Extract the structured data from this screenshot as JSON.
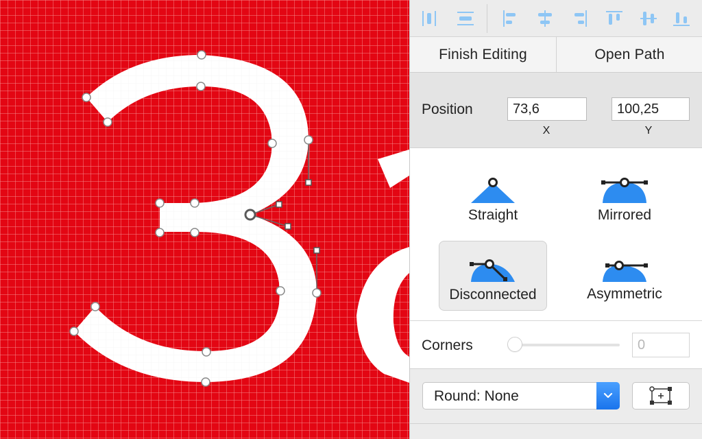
{
  "colors": {
    "canvas_red": "#e30613",
    "grid": "#f38a8a",
    "accent_blue": "#2d8cf0",
    "icon_blue": "#8ec6f5"
  },
  "toolbar": {
    "icons": [
      "distribute-horizontal-icon",
      "distribute-vertical-icon",
      "align-left-icon",
      "align-horizontal-center-icon",
      "align-right-icon",
      "align-top-icon",
      "align-vertical-center-icon",
      "align-bottom-icon"
    ]
  },
  "edit_bar": {
    "finish_label": "Finish Editing",
    "open_path_label": "Open Path"
  },
  "position": {
    "label": "Position",
    "x_value": "73,6",
    "y_value": "100,25",
    "x_caption": "X",
    "y_caption": "Y"
  },
  "point_types": {
    "selected": "Disconnected",
    "options": [
      {
        "label": "Straight",
        "icon": "straight-point-icon"
      },
      {
        "label": "Mirrored",
        "icon": "mirrored-point-icon"
      },
      {
        "label": "Disconnected",
        "icon": "disconnected-point-icon"
      },
      {
        "label": "Asymmetric",
        "icon": "asymmetric-point-icon"
      }
    ]
  },
  "corners": {
    "label": "Corners",
    "value": "0",
    "slider_level": 0
  },
  "round": {
    "selected": "Round: None"
  },
  "canvas": {
    "glyph": "3"
  }
}
